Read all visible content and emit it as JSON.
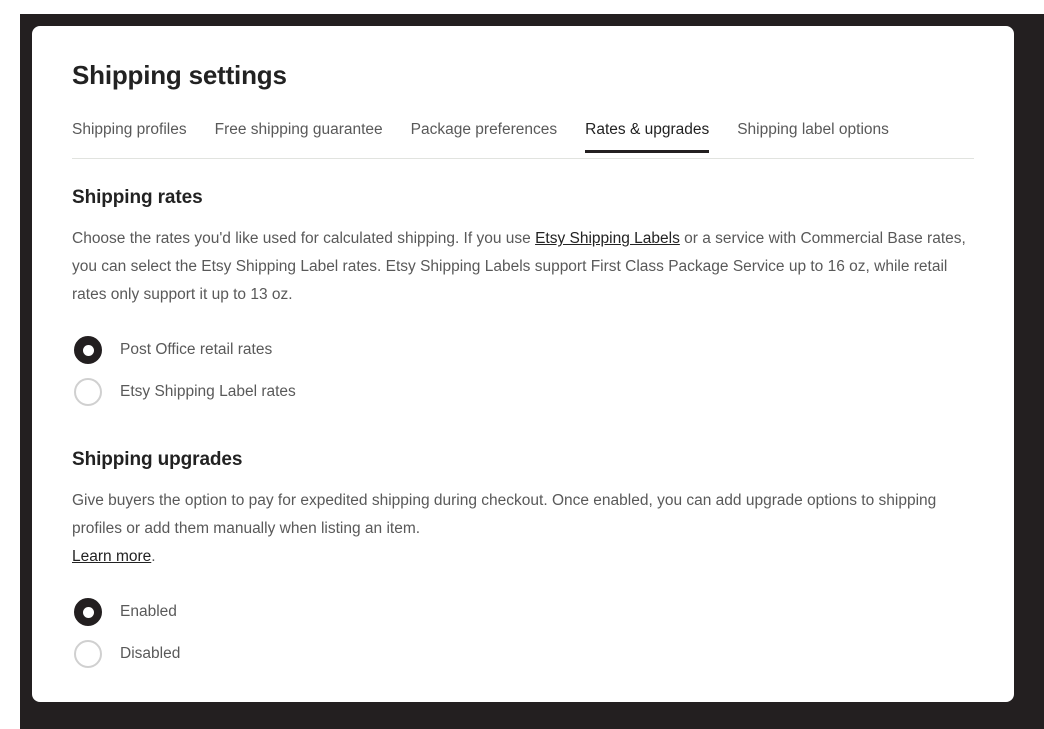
{
  "page": {
    "title": "Shipping settings"
  },
  "tabs": [
    {
      "label": "Shipping profiles",
      "active": false
    },
    {
      "label": "Free shipping guarantee",
      "active": false
    },
    {
      "label": "Package preferences",
      "active": false
    },
    {
      "label": "Rates & upgrades",
      "active": true
    },
    {
      "label": "Shipping label options",
      "active": false
    }
  ],
  "shipping_rates": {
    "heading": "Shipping rates",
    "description_part1": "Choose the rates you'd like used for calculated shipping. If you use ",
    "description_link": "Etsy Shipping Labels",
    "description_part2": " or a service with Commercial Base rates, you can select the Etsy Shipping Label rates. Etsy Shipping Labels support First Class Package Service up to 16 oz, while retail rates only support it up to 13 oz.",
    "options": [
      {
        "label": "Post Office retail rates",
        "selected": true
      },
      {
        "label": "Etsy Shipping Label rates",
        "selected": false
      }
    ]
  },
  "shipping_upgrades": {
    "heading": "Shipping upgrades",
    "description": "Give buyers the option to pay for expedited shipping during checkout. Once enabled, you can add upgrade options to shipping profiles or add them manually when listing an item. ",
    "learn_more_link": "Learn more",
    "learn_more_suffix": ".",
    "options": [
      {
        "label": "Enabled",
        "selected": true
      },
      {
        "label": "Disabled",
        "selected": false
      }
    ]
  },
  "colors": {
    "frame": "#231f20",
    "card": "#ffffff",
    "text_primary": "#222222",
    "text_secondary": "#595959",
    "divider": "#e1e3df",
    "radio_unselected_border": "#d0d0d0"
  }
}
